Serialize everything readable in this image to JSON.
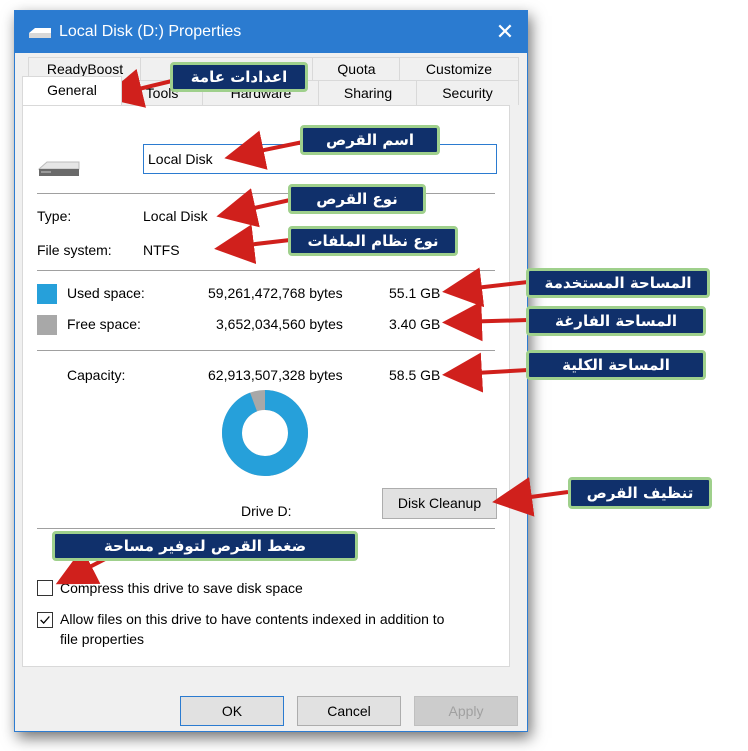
{
  "window": {
    "title": "Local Disk (D:) Properties",
    "close_glyph": "✕",
    "icon": "drive-icon"
  },
  "tabs": {
    "row1": [
      "ReadyBoost",
      "",
      "Quota",
      "Customize"
    ],
    "row2": [
      "General",
      "Tools",
      "Hardware",
      "Sharing",
      "Security"
    ],
    "active": "General"
  },
  "general": {
    "drive_name": "Local Disk",
    "type_label": "Type:",
    "type_value": "Local Disk",
    "fs_label": "File system:",
    "fs_value": "NTFS",
    "used_label": "Used space:",
    "used_bytes": "59,261,472,768 bytes",
    "used_gb": "55.1 GB",
    "free_label": "Free space:",
    "free_bytes": "3,652,034,560 bytes",
    "free_gb": "3.40 GB",
    "capacity_label": "Capacity:",
    "capacity_bytes": "62,913,507,328 bytes",
    "capacity_gb": "58.5 GB",
    "drive_label": "Drive D:",
    "used_fraction": 0.942,
    "cleanup_button": "Disk Cleanup",
    "compress_label": "Compress this drive to save disk space",
    "compress_checked": false,
    "index_label_line1": "Allow files on this drive to have contents indexed in addition to",
    "index_label_line2": "file properties",
    "index_checked": true
  },
  "buttons": {
    "ok": "OK",
    "cancel": "Cancel",
    "apply": "Apply"
  },
  "colors": {
    "used": "#26a0da",
    "free": "#a8a8a8",
    "accent": "#2b7bd0",
    "callout_bg": "#10306b",
    "callout_border": "#9fd08c",
    "arrow": "#d0201c"
  },
  "callouts": {
    "general_settings": "اعدادات عامة",
    "disk_name": "اسم القرص",
    "disk_type": "نوع القرص",
    "file_system_type": "نوع نظام الملفات",
    "used_space": "المساحة المستخدمة",
    "free_space": "المساحة الفارغة",
    "total_space": "المساحة الكلية",
    "disk_cleanup": "تنظيف القرص",
    "compress_disk": "ضغط القرص لتوفير مساحة"
  }
}
